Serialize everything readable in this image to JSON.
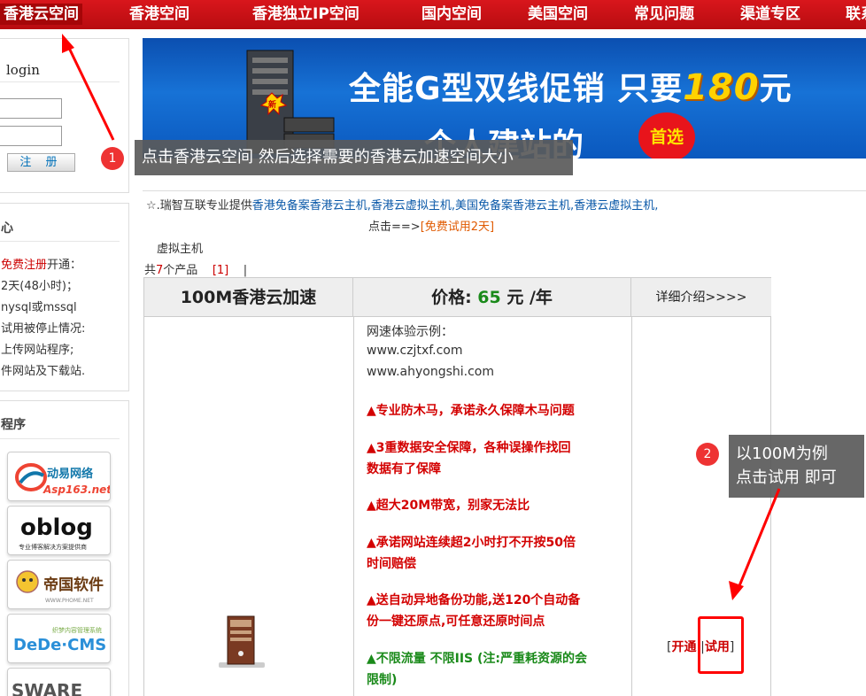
{
  "nav": {
    "items": [
      "香港云空间",
      "香港空间",
      "香港独立IP空间",
      "国内空间",
      "美国空间",
      "常见问题",
      "渠道专区",
      "联系"
    ]
  },
  "login": {
    "title": "login",
    "register_label": "注 册"
  },
  "member": {
    "title": "心",
    "lines": [
      {
        "link": "免费注册",
        "text": "开通："
      },
      {
        "text": "2天(48小时)；"
      },
      {
        "text": "nysql或mssql"
      },
      {
        "text": "试用被停止情况:"
      },
      {
        "text": "上传网站程序;"
      },
      {
        "text": "件网站及下载站."
      }
    ]
  },
  "programs": {
    "title": "程序",
    "logos": [
      {
        "name": "动易网络",
        "sub": "Asp163.net"
      },
      {
        "name": "oblog",
        "sub": "专业博客解决方案提供商"
      },
      {
        "name": "帝国软件",
        "sub": "WWW.PHOME.NET"
      },
      {
        "name": "DeDe·CMS",
        "sub": "织梦内容管理系统"
      },
      {
        "name": "SWARE",
        "sub": ""
      }
    ]
  },
  "banner": {
    "line1": "全能G型双线促销 只要",
    "price": "180",
    "price_suffix": "元",
    "line2": "个人建站的",
    "badge": "首选",
    "new_tag": "新"
  },
  "annotations": {
    "marker1": "1",
    "tooltip1": "点击香港云空间  然后选择需要的香港云加速空间大小",
    "marker2": "2",
    "tooltip2_line1": "以100M为例",
    "tooltip2_line2": "点击试用 即可"
  },
  "info": {
    "promo_prefix": "☆.瑞智互联专业提供",
    "promo_links": "香港免备案香港云主机,香港云虚拟主机,美国免备案香港云主机,香港云虚拟主机,",
    "trial_prefix": "点击==>",
    "trial_link": "[免费试用2天]",
    "breadcrumb": "虚拟主机",
    "count_prefix": "共",
    "count_num": "7",
    "count_suffix": "个产品",
    "page_link": "[1]",
    "page_sep": "|"
  },
  "product": {
    "name": "100M香港云加速",
    "price_label": "价格:",
    "price_value": "65",
    "price_unit": "元 /年",
    "detail_link": "详细介绍>>>>",
    "speed_title": "网速体验示例：",
    "speed_site1": "www.czjtxf.com",
    "speed_site2": "www.ahyongshi.com",
    "features": [
      "▲专业防木马，承诺永久保障木马问题",
      "▲3重数据安全保障，各种误操作找回",
      "数据有了保障",
      "▲超大20M带宽，别家无法比",
      "▲承诺网站连续超2小时打不开按50倍",
      "时间赔偿",
      "▲送自动异地备份功能,送120个自动备",
      "份一键还原点,可任意还原时间点"
    ],
    "feature_green_1": "▲不限流量 不限IIS (注:严重耗资源的会",
    "feature_green_2": "限制)",
    "action_open": "开通",
    "action_sep": "||",
    "action_trial": "试用"
  }
}
